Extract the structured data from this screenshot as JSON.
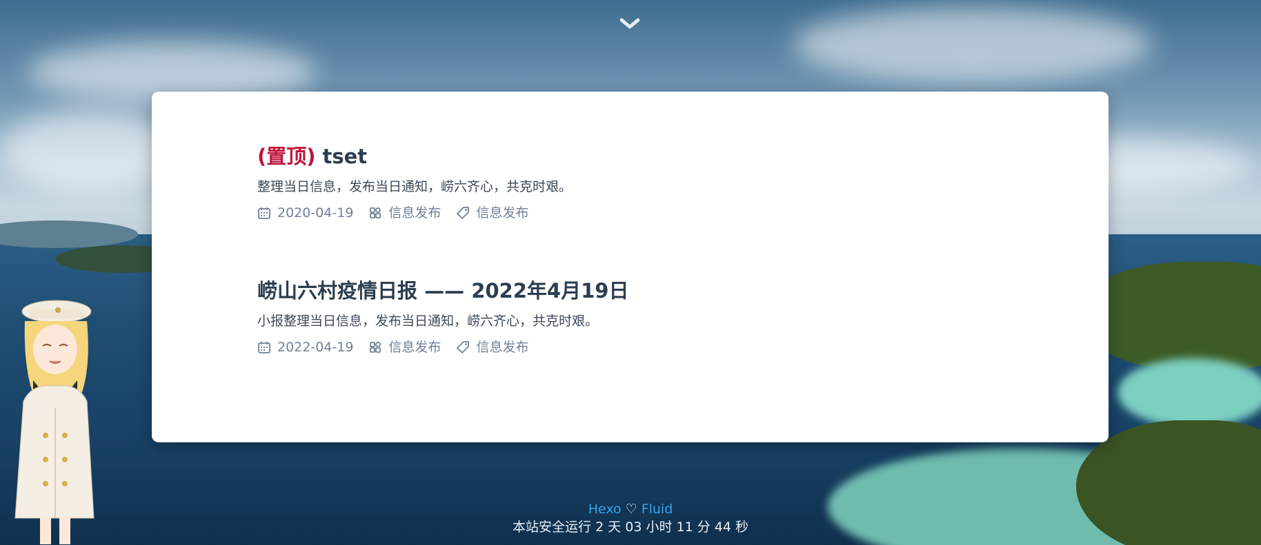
{
  "scroll": {
    "icon": "chevron-down-icon"
  },
  "posts": [
    {
      "pin_label": "(置顶)",
      "title": "tset",
      "excerpt": "整理当日信息，发布当日通知，崂六齐心，共克时艰。",
      "date": "2020-04-19",
      "category": "信息发布",
      "tag": "信息发布"
    },
    {
      "title": "崂山六村疫情日报 —— 2022年4月19日",
      "excerpt": "小报整理当日信息，发布当日通知，崂六齐心，共克时艰。",
      "date": "2022-04-19",
      "category": "信息发布",
      "tag": "信息发布"
    }
  ],
  "footer": {
    "hexo": "Hexo",
    "heart": "♡",
    "fluid": "Fluid",
    "uptime": "本站安全运行 2 天 03 小时 11 分 44 秒"
  },
  "icons": {
    "date": "calendar-icon",
    "category": "category-icon",
    "tag": "tag-icon"
  },
  "colors": {
    "pin": "#c0143c",
    "title": "#2c3e50",
    "meta": "#718096",
    "footer_link": "#34a5ef"
  }
}
